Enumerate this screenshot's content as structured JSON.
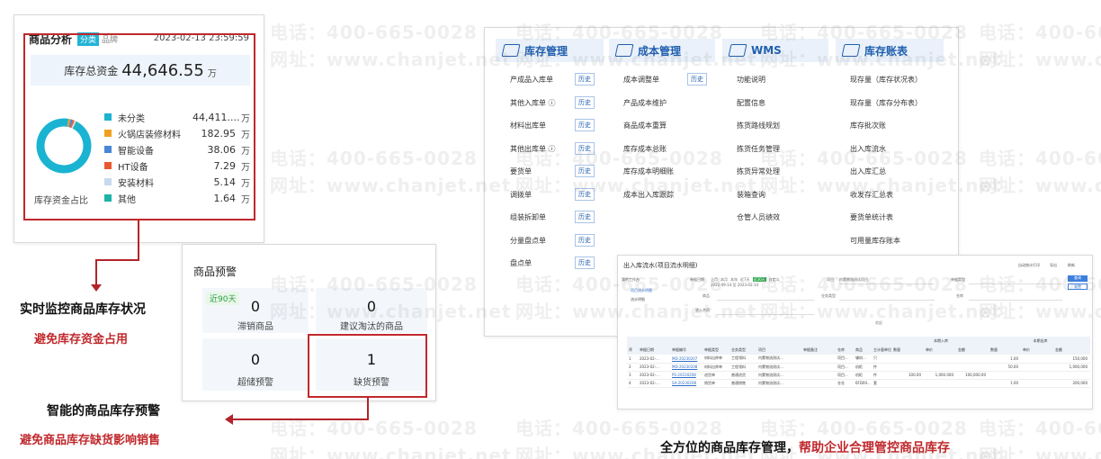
{
  "watermarks": [
    {
      "text": "电话：400-665-0028"
    },
    {
      "text": "网址：www.chanjet.net"
    }
  ],
  "analysis": {
    "title": "商品分析",
    "tab_active": "分类",
    "tab_inactive": "品牌",
    "timestamp": "2023-02-13 23:59:59",
    "total_label": "库存总资金",
    "total_value": "44,646.55",
    "total_unit": "万",
    "donut_caption": "库存资金占比",
    "legend": [
      {
        "name": "未分类",
        "value": "44,411....",
        "unit": "万",
        "color": "#1ab3d2",
        "share": 0.9947
      },
      {
        "name": "火锅店装修材料",
        "value": "182.95",
        "unit": "万",
        "color": "#f0a020",
        "share": 0.0041
      },
      {
        "name": "智能设备",
        "value": "38.06",
        "unit": "万",
        "color": "#4a86d8",
        "share": 0.0009
      },
      {
        "name": "HT设备",
        "value": "7.29",
        "unit": "万",
        "color": "#e9592f",
        "share": 0.0002
      },
      {
        "name": "安装材料",
        "value": "5.14",
        "unit": "万",
        "color": "#c8d9ef",
        "share": 0.0001
      },
      {
        "name": "其他",
        "value": "1.64",
        "unit": "万",
        "color": "#1ab3a8",
        "share": 0.0
      }
    ]
  },
  "warning": {
    "title": "商品预警",
    "period_tag": "近90天",
    "cards": [
      {
        "value": "0",
        "label": "滞销商品"
      },
      {
        "value": "0",
        "label": "建议淘汰的商品"
      },
      {
        "value": "0",
        "label": "超储预警"
      },
      {
        "value": "1",
        "label": "缺货预警"
      }
    ]
  },
  "feature1": {
    "title": "实时监控商品库存状况",
    "subtitle": "避免库存资金占用"
  },
  "feature2": {
    "title": "智能的商品库存预警",
    "subtitle": "避免商品库存缺货影响销售"
  },
  "menu": {
    "history_label": "历史",
    "columns": [
      {
        "title": "库存管理",
        "items": [
          {
            "label": "产成品入库单",
            "history": true
          },
          {
            "label": "其他入库单 ⓘ",
            "history": true
          },
          {
            "label": "材料出库单",
            "history": true
          },
          {
            "label": "其他出库单 ⓘ",
            "history": true
          },
          {
            "label": "要货单",
            "history": true
          },
          {
            "label": "调拨单",
            "history": true
          },
          {
            "label": "组装拆卸单",
            "history": true
          },
          {
            "label": "分量盘点单",
            "history": true
          },
          {
            "label": "盘点单",
            "history": true
          }
        ]
      },
      {
        "title": "成本管理",
        "items": [
          {
            "label": "成本调整单",
            "history": true
          },
          {
            "label": "产品成本维护",
            "history": false
          },
          {
            "label": "商品成本重算",
            "history": false
          },
          {
            "label": "库存成本总账",
            "history": false
          },
          {
            "label": "库存成本明细账",
            "history": false
          },
          {
            "label": "成本出入库跟踪",
            "history": false
          }
        ]
      },
      {
        "title": "WMS",
        "items": [
          {
            "label": "功能说明",
            "history": false
          },
          {
            "label": "配置信息",
            "history": false
          },
          {
            "label": "拣货路线规划",
            "history": false
          },
          {
            "label": "拣货任务管理",
            "history": false
          },
          {
            "label": "拣货异常处理",
            "history": false
          },
          {
            "label": "装箱查询",
            "history": false
          },
          {
            "label": "仓管人员绩效",
            "history": false
          }
        ]
      },
      {
        "title": "库存账表",
        "items": [
          {
            "label": "现存量（库存状况表）",
            "history": false
          },
          {
            "label": "现存量（库存分布表）",
            "history": false
          },
          {
            "label": "库存批次账",
            "history": false
          },
          {
            "label": "出入库流水",
            "history": false
          },
          {
            "label": "出入库汇总",
            "history": false
          },
          {
            "label": "收发存汇总表",
            "history": false
          },
          {
            "label": "要货单统计表",
            "history": false
          },
          {
            "label": "可用量库存账本",
            "history": false
          }
        ]
      }
    ]
  },
  "report": {
    "title": "出入库流水(项目流水明细)",
    "left_title": "我的工作台",
    "left_items": [
      "项目流水明细",
      "流水明细"
    ],
    "filters": {
      "date_label": "单据日期",
      "date_quick": [
        "上月",
        "本月",
        "本年",
        "近7天",
        "近30天",
        "自定义"
      ],
      "date_range": "2022-09-14 至 2023-02-14",
      "project_label": "项目",
      "project_value": "内蒙物流测试项目",
      "doc_type_label": "单据类型",
      "goods_label": "商品",
      "business_type_label": "业务类型",
      "warehouse_label": "仓库",
      "contract_label": "收入合同"
    },
    "buttons": {
      "search": "查询",
      "reset": "重置",
      "toggle": "收起"
    },
    "top_actions": [
      "自动统计打印",
      "导出",
      "刷新"
    ],
    "columns": [
      "序",
      "单据日期",
      "单据编号",
      "单据类型",
      "业务类型",
      "项目",
      "单据备注",
      "仓库",
      "商品",
      "主计量单位",
      "数量",
      "单价",
      "金额",
      "数量",
      "单价",
      "金额"
    ],
    "group_headers": [
      "本期入库",
      "本期出库"
    ],
    "rows": [
      [
        "1",
        "2023-02-...",
        "MD-20230207",
        "材料出库单",
        "工程领料",
        "内蒙物流测试...",
        "",
        "项目...",
        "辅材...",
        "只",
        "",
        "",
        "",
        "1.00",
        "",
        "150,000"
      ],
      [
        "2",
        "2023-02-...",
        "MD-20230208",
        "材料出库单",
        "工程领料",
        "内蒙物流测试...",
        "",
        "项目...",
        "机柜",
        "件",
        "",
        "",
        "",
        "50.00",
        "",
        "1,000,000"
      ],
      [
        "3",
        "2023-02-...",
        "PS-20230208",
        "进货单",
        "普通进货",
        "内蒙物流测试...",
        "",
        "项目...",
        "机柜",
        "件",
        "100.00",
        "1,000.000",
        "100,000.00",
        "",
        "",
        ""
      ],
      [
        "4",
        "2023-02-...",
        "SA-20230208",
        "销货单",
        "普通销售",
        "内蒙物流测试...",
        "",
        "仓仓",
        "6FD00...",
        "套",
        "",
        "",
        "",
        "1.00",
        "",
        "200,000"
      ]
    ]
  },
  "bottom_caption": {
    "part1": "全方位的商品库存管理，",
    "part2": "帮助企业合理管控商品库存"
  },
  "colors": {
    "accent_red": "#c0282c",
    "brand_blue": "#1f5fae",
    "tab_cyan": "#21b3d6"
  }
}
